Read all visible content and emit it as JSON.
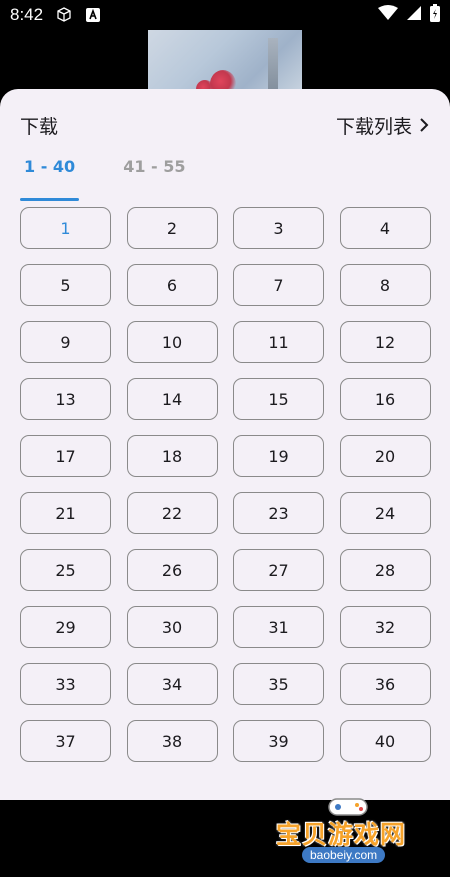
{
  "status_bar": {
    "time": "8:42"
  },
  "sheet": {
    "title": "下载",
    "list_link_label": "下载列表",
    "tabs": [
      {
        "label": "1 - 40",
        "active": true
      },
      {
        "label": "41 - 55",
        "active": false
      }
    ],
    "episodes": [
      "1",
      "2",
      "3",
      "4",
      "5",
      "6",
      "7",
      "8",
      "9",
      "10",
      "11",
      "12",
      "13",
      "14",
      "15",
      "16",
      "17",
      "18",
      "19",
      "20",
      "21",
      "22",
      "23",
      "24",
      "25",
      "26",
      "27",
      "28",
      "29",
      "30",
      "31",
      "32",
      "33",
      "34",
      "35",
      "36",
      "37",
      "38",
      "39",
      "40"
    ],
    "selected_episode": "1"
  },
  "watermark": {
    "text": "宝贝游戏网",
    "url": "baobeiy.com"
  },
  "colors": {
    "accent": "#2f8ad8",
    "sheet_bg": "#f4f0f7",
    "watermark": "#f6a32b"
  }
}
